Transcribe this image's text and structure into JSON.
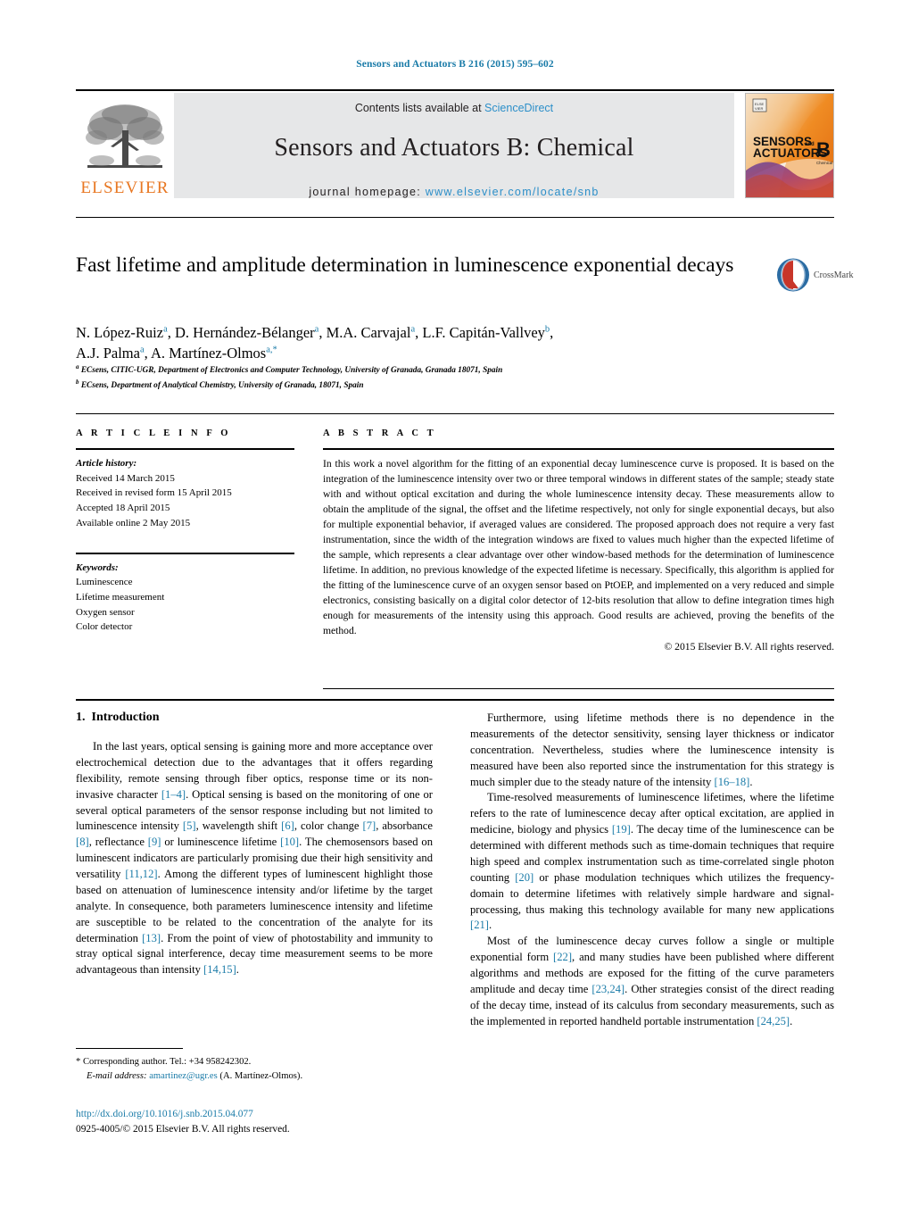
{
  "running_head": "Sensors and Actuators B 216 (2015) 595–602",
  "journal_header": {
    "contents_prefix": "Contents lists available at ",
    "sciencedirect": "ScienceDirect",
    "journal_title": "Sensors and Actuators B: Chemical",
    "homepage_label": "journal homepage: ",
    "homepage_url": "www.elsevier.com/locate/snb",
    "publisher_wordmark": "ELSEVIER",
    "cover_line1": "SENSORS",
    "cover_and": "and",
    "cover_line2": "ACTUATORS",
    "cover_letter": "B",
    "cover_sub": "Chemical",
    "accent_orange": "#E87722",
    "link_blue": "#2c8fc9"
  },
  "crossmark": {
    "label": "CrossMark"
  },
  "article": {
    "title": "Fast lifetime and amplitude determination in luminescence exponential decays",
    "authors_line1_parts": [
      {
        "name": "N. López-Ruiz",
        "sup": "a"
      },
      {
        "name": "D. Hernández-Bélanger",
        "sup": "a"
      },
      {
        "name": "M.A. Carvajal",
        "sup": "a"
      },
      {
        "name": "L.F. Capitán-Vallvey",
        "sup": "b"
      }
    ],
    "authors_line2_parts": [
      {
        "name": "A.J. Palma",
        "sup": "a"
      },
      {
        "name": "A. Martínez-Olmos",
        "sup": "a,*"
      }
    ],
    "affiliations": [
      {
        "marker": "a",
        "text": "ECsens, CITIC-UGR, Department of Electronics and Computer Technology, University of Granada, Granada 18071, Spain"
      },
      {
        "marker": "b",
        "text": "ECsens, Department of Analytical Chemistry, University of Granada, 18071, Spain"
      }
    ]
  },
  "info": {
    "kicker": "A R T I C L E    I N F O",
    "history_title": "Article history:",
    "history": [
      "Received 14 March 2015",
      "Received in revised form 15 April 2015",
      "Accepted 18 April 2015",
      "Available online 2 May 2015"
    ],
    "keywords_title": "Keywords:",
    "keywords": [
      "Luminescence",
      "Lifetime measurement",
      "Oxygen sensor",
      "Color detector"
    ]
  },
  "abstract": {
    "kicker": "A B S T R A C T",
    "text": "In this work a novel algorithm for the fitting of an exponential decay luminescence curve is proposed. It is based on the integration of the luminescence intensity over two or three temporal windows in different states of the sample; steady state with and without optical excitation and during the whole luminescence intensity decay. These measurements allow to obtain the amplitude of the signal, the offset and the lifetime respectively, not only for single exponential decays, but also for multiple exponential behavior, if averaged values are considered. The proposed approach does not require a very fast instrumentation, since the width of the integration windows are fixed to values much higher than the expected lifetime of the sample, which represents a clear advantage over other window-based methods for the determination of luminescence lifetime. In addition, no previous knowledge of the expected lifetime is necessary. Specifically, this algorithm is applied for the fitting of the luminescence curve of an oxygen sensor based on PtOEP, and implemented on a very reduced and simple electronics, consisting basically on a digital color detector of 12-bits resolution that allow to define integration times high enough for measurements of the intensity using this approach. Good results are achieved, proving the benefits of the method.",
    "copyright": "© 2015 Elsevier B.V. All rights reserved."
  },
  "body": {
    "section_number": "1.",
    "section_title": "Introduction",
    "left_paragraphs": [
      [
        {
          "t": "In the last years, optical sensing is gaining more and more acceptance over electrochemical detection due to the advantages that it offers regarding flexibility, remote sensing through fiber optics, response time or its non-invasive character "
        },
        {
          "t": "[1–4]",
          "r": true
        },
        {
          "t": ". Optical sensing is based on the monitoring of one or several optical parameters of the sensor response including but not limited to luminescence intensity "
        },
        {
          "t": "[5]",
          "r": true
        },
        {
          "t": ", wavelength shift "
        },
        {
          "t": "[6]",
          "r": true
        },
        {
          "t": ", color change "
        },
        {
          "t": "[7]",
          "r": true
        },
        {
          "t": ", absorbance "
        },
        {
          "t": "[8]",
          "r": true
        },
        {
          "t": ", reflectance "
        },
        {
          "t": "[9]",
          "r": true
        },
        {
          "t": " or luminescence lifetime "
        },
        {
          "t": "[10]",
          "r": true
        },
        {
          "t": ". The chemosensors based on luminescent indicators are particularly promising due their high sensitivity and versatility "
        },
        {
          "t": "[11,12]",
          "r": true
        },
        {
          "t": ". Among the different types of luminescent highlight those based on attenuation of luminescence intensity and/or lifetime by the target analyte. In consequence, both parameters luminescence intensity and lifetime are susceptible to be related to the concentration of the analyte for its determination "
        },
        {
          "t": "[13]",
          "r": true
        },
        {
          "t": ". From the point of view of photostability and immunity to stray optical signal interference, decay time measurement seems to be more advantageous than intensity "
        },
        {
          "t": "[14,15]",
          "r": true
        },
        {
          "t": "."
        }
      ]
    ],
    "right_paragraphs": [
      [
        {
          "t": "Furthermore, using lifetime methods there is no dependence in the measurements of the detector sensitivity, sensing layer thickness or indicator concentration. Nevertheless, studies where the luminescence intensity is measured have been also reported since the instrumentation for this strategy is much simpler due to the steady nature of the intensity "
        },
        {
          "t": "[16–18]",
          "r": true
        },
        {
          "t": "."
        }
      ],
      [
        {
          "t": "Time-resolved measurements of luminescence lifetimes, where the lifetime refers to the rate of luminescence decay after optical excitation, are applied in medicine, biology and physics "
        },
        {
          "t": "[19]",
          "r": true
        },
        {
          "t": ". The decay time of the luminescence can be determined with different methods such as time-domain techniques that require high speed and complex instrumentation such as time-correlated single photon counting "
        },
        {
          "t": "[20]",
          "r": true
        },
        {
          "t": " or phase modulation techniques which utilizes the frequency-domain to determine lifetimes with relatively simple hardware and signal-processing, thus making this technology available for many new applications "
        },
        {
          "t": "[21]",
          "r": true
        },
        {
          "t": "."
        }
      ],
      [
        {
          "t": "Most of the luminescence decay curves follow a single or multiple exponential form "
        },
        {
          "t": "[22]",
          "r": true
        },
        {
          "t": ", and many studies have been published where different algorithms and methods are exposed for the fitting of the curve parameters amplitude and decay time "
        },
        {
          "t": "[23,24]",
          "r": true
        },
        {
          "t": ". Other strategies consist of the direct reading of the decay time, instead of its calculus from secondary measurements, such as the implemented in reported handheld portable instrumentation "
        },
        {
          "t": "[24,25]",
          "r": true
        },
        {
          "t": "."
        }
      ]
    ]
  },
  "footnote": {
    "marker": "*",
    "corresponding": "Corresponding author. Tel.: +34 958242302.",
    "email_label": "E-mail address:",
    "email": "amartinez@ugr.es",
    "email_suffix": "(A. Martínez-Olmos)."
  },
  "imprint": {
    "doi": "http://dx.doi.org/10.1016/j.snb.2015.04.077",
    "issn_line": "0925-4005/© 2015 Elsevier B.V. All rights reserved."
  }
}
